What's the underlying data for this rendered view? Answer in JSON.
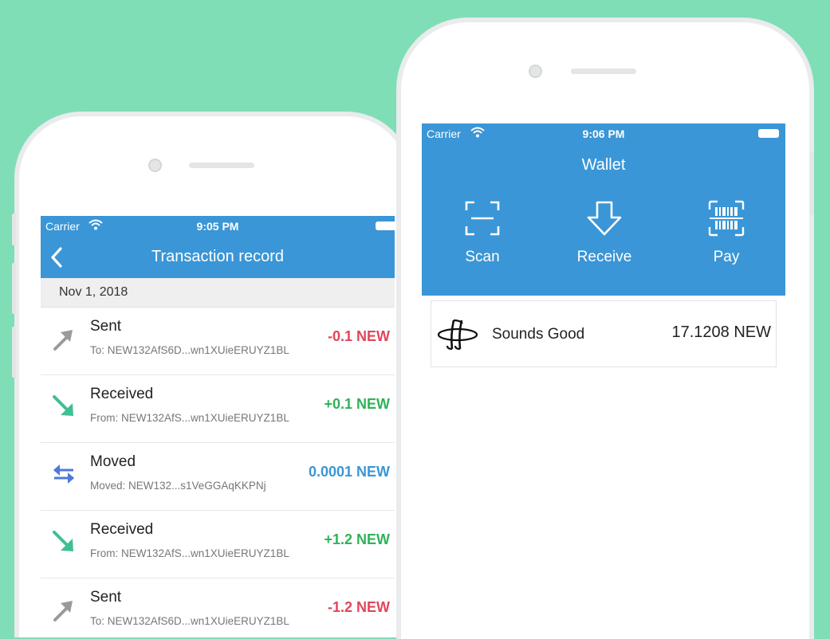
{
  "colors": {
    "background": "#7fdeb6",
    "header": "#3a96d6",
    "negative": "#e2455a",
    "positive": "#2fb25a",
    "moved": "#3a96d6"
  },
  "left_screen": {
    "status_bar": {
      "carrier": "Carrier",
      "time": "9:05 PM"
    },
    "nav": {
      "title": "Transaction record",
      "back_icon": "chevron-left-icon"
    },
    "date_header": "Nov 1, 2018",
    "transactions": [
      {
        "type": "Sent",
        "address": "To: NEW132AfS6D...wn1XUieERUYZ1BL",
        "amount": "-0.1 NEW",
        "icon": "arrow-up-right-icon"
      },
      {
        "type": "Received",
        "address": "From: NEW132AfS...wn1XUieERUYZ1BL",
        "amount": "+0.1 NEW",
        "icon": "arrow-down-right-icon"
      },
      {
        "type": "Moved",
        "address": "Moved: NEW132...s1VeGGAqKKPNj",
        "amount": "0.0001 NEW",
        "icon": "swap-arrows-icon"
      },
      {
        "type": "Received",
        "address": "From: NEW132AfS...wn1XUieERUYZ1BL",
        "amount": "+1.2 NEW",
        "icon": "arrow-down-right-icon"
      },
      {
        "type": "Sent",
        "address": "To: NEW132AfS6D...wn1XUieERUYZ1BL",
        "amount": "-1.2 NEW",
        "icon": "arrow-up-right-icon"
      }
    ]
  },
  "right_screen": {
    "status_bar": {
      "carrier": "Carrier",
      "time": "9:06 PM"
    },
    "title": "Wallet",
    "actions": [
      {
        "label": "Scan",
        "icon": "scan-icon"
      },
      {
        "label": "Receive",
        "icon": "receive-arrow-icon"
      },
      {
        "label": "Pay",
        "icon": "barcode-pay-icon"
      }
    ],
    "token": {
      "name": "Sounds Good",
      "balance": "17.1208 NEW",
      "icon": "sounds-good-logo-icon"
    }
  }
}
